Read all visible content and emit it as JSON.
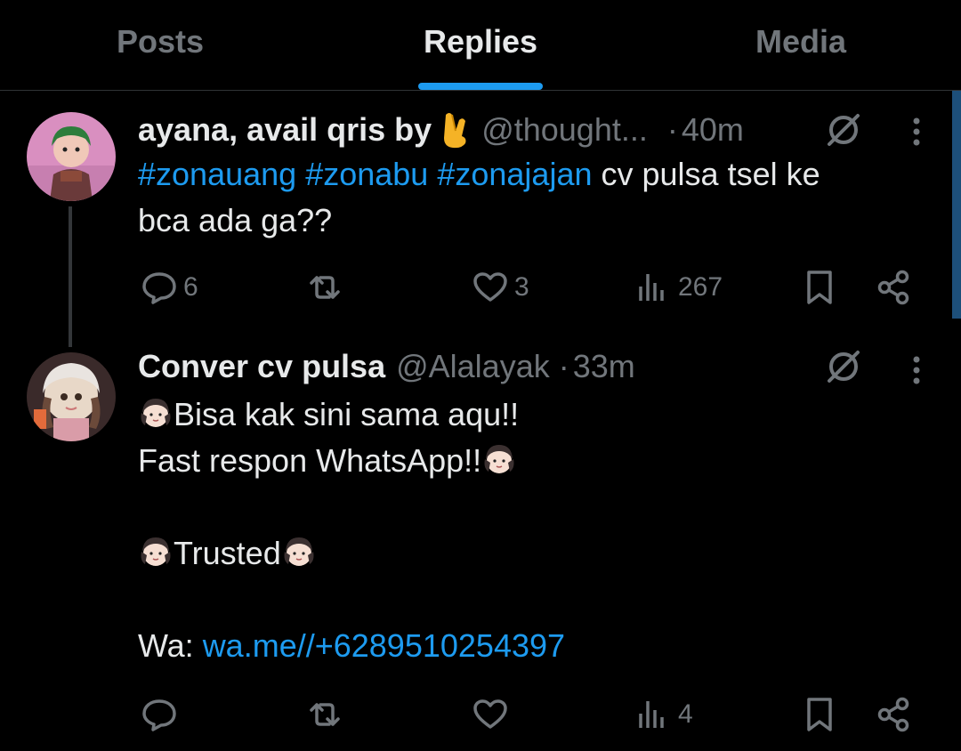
{
  "tabs": [
    {
      "label": "Posts"
    },
    {
      "label": "Replies"
    },
    {
      "label": "Media"
    }
  ],
  "active_tab": "Replies",
  "accent_color": "#1d9bf0",
  "tweets": [
    {
      "name": "ayana, avail qris by",
      "name_emoji": "hand-with-index-finger-and-thumb-crossed",
      "handle": "@thought...",
      "separator": "·",
      "time": "40m",
      "body": {
        "hashtags": [
          "#zonauang",
          "#zonabu",
          "#zonajajan"
        ],
        "text_line1": "cv pulsa tsel ke",
        "text_line2": "bca ada ga??"
      },
      "stats": {
        "replies": "6",
        "reposts": "",
        "likes": "3",
        "views": "267"
      }
    },
    {
      "name": "Conver cv pulsa",
      "handle": "@Alalayak",
      "separator": "·",
      "time": "33m",
      "body": {
        "line1": "Bisa kak sini sama aqu!!",
        "line2": "Fast respon WhatsApp!!",
        "line3": "Trusted",
        "wa_label": "Wa:",
        "wa_link": "wa.me//+6289510254397"
      },
      "stats": {
        "replies": "",
        "reposts": "",
        "likes": "",
        "views": "4"
      }
    }
  ]
}
